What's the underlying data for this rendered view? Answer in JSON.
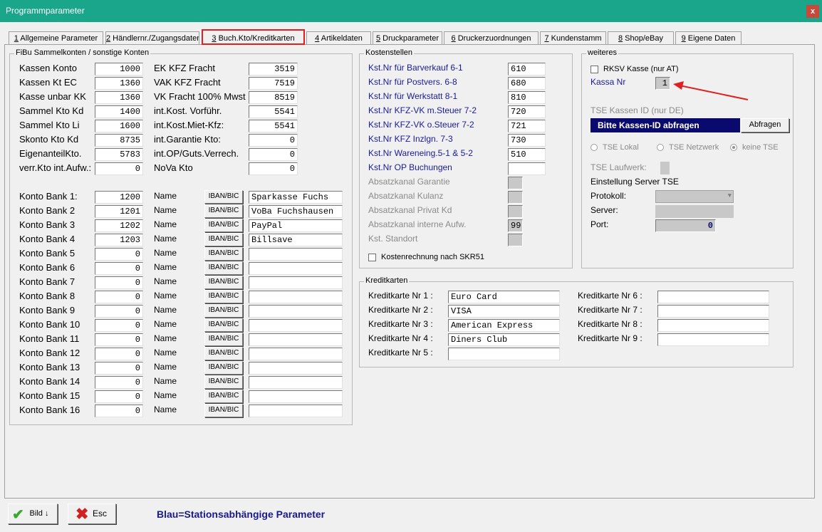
{
  "window": {
    "title": "Programmparameter",
    "close": "x"
  },
  "tabs": [
    {
      "num": "1",
      "label": " Allgemeine Parameter"
    },
    {
      "num": "2",
      "label": " Händlernr./Zugangsdaten"
    },
    {
      "num": "3",
      "label": " Buch.Kto/Kreditkarten"
    },
    {
      "num": "4",
      "label": " Artikeldaten"
    },
    {
      "num": "5",
      "label": " Druckparameter"
    },
    {
      "num": "6",
      "label": " Druckerzuordnungen"
    },
    {
      "num": "7",
      "label": " Kundenstamm"
    },
    {
      "num": "8",
      "label": " Shop/eBay"
    },
    {
      "num": "9",
      "label": " Eigene Daten"
    }
  ],
  "fibu": {
    "legend": "FiBu Sammelkonten / sonstige Konten",
    "left": [
      {
        "label": "Kassen Konto",
        "value": "1000"
      },
      {
        "label": "Kassen Kt EC",
        "value": "1360"
      },
      {
        "label": "Kasse unbar KK",
        "value": "1360"
      },
      {
        "label": "Sammel Kto Kd",
        "value": "1400"
      },
      {
        "label": "Sammel Kto Li",
        "value": "1600"
      },
      {
        "label": "Skonto Kto Kd",
        "value": "8735"
      },
      {
        "label": "EigenanteilKto.",
        "value": "5783"
      },
      {
        "label": "verr.Kto int.Aufw.:",
        "value": "0"
      }
    ],
    "right": [
      {
        "label": "EK KFZ Fracht",
        "value": "3519"
      },
      {
        "label": "VAK KFZ Fracht",
        "value": "7519"
      },
      {
        "label": "VK Fracht 100% Mwst",
        "value": "8519"
      },
      {
        "label": "int.Kost. Vorführ.",
        "value": "5541"
      },
      {
        "label": "int.Kost.Miet-Kfz:",
        "value": "5541"
      },
      {
        "label": "int.Garantie Kto:",
        "value": "0"
      },
      {
        "label": "int.OP/Guts.Verrech.",
        "value": "0"
      },
      {
        "label": "NoVa Kto",
        "value": "0"
      }
    ],
    "banks": [
      {
        "label": "Konto Bank 1:",
        "value": "1200",
        "name_label": "Name",
        "iban": "IBAN/BIC",
        "name": "Sparkasse Fuchs"
      },
      {
        "label": "Konto Bank 2",
        "value": "1201",
        "name_label": "Name",
        "iban": "IBAN/BIC",
        "name": "VoBa Fuchshausen"
      },
      {
        "label": "Konto Bank 3",
        "value": "1202",
        "name_label": "Name",
        "iban": "IBAN/BIC",
        "name": "PayPal"
      },
      {
        "label": "Konto Bank 4",
        "value": "1203",
        "name_label": "Name",
        "iban": "IBAN/BIC",
        "name": "Billsave"
      },
      {
        "label": "Konto Bank 5",
        "value": "0",
        "name_label": "Name",
        "iban": "IBAN/BIC",
        "name": ""
      },
      {
        "label": "Konto Bank 6",
        "value": "0",
        "name_label": "Name",
        "iban": "IBAN/BIC",
        "name": ""
      },
      {
        "label": "Konto Bank 7",
        "value": "0",
        "name_label": "Name",
        "iban": "IBAN/BIC",
        "name": ""
      },
      {
        "label": "Konto Bank 8",
        "value": "0",
        "name_label": "Name",
        "iban": "IBAN/BIC",
        "name": ""
      },
      {
        "label": "Konto Bank 9",
        "value": "0",
        "name_label": "Name",
        "iban": "IBAN/BIC",
        "name": ""
      },
      {
        "label": "Konto Bank 10",
        "value": "0",
        "name_label": "Name",
        "iban": "IBAN/BIC",
        "name": ""
      },
      {
        "label": "Konto Bank 11",
        "value": "0",
        "name_label": "Name",
        "iban": "IBAN/BIC",
        "name": ""
      },
      {
        "label": "Konto Bank 12",
        "value": "0",
        "name_label": "Name",
        "iban": "IBAN/BIC",
        "name": ""
      },
      {
        "label": "Konto Bank 13",
        "value": "0",
        "name_label": "Name",
        "iban": "IBAN/BIC",
        "name": ""
      },
      {
        "label": "Konto Bank 14",
        "value": "0",
        "name_label": "Name",
        "iban": "IBAN/BIC",
        "name": ""
      },
      {
        "label": "Konto Bank 15",
        "value": "0",
        "name_label": "Name",
        "iban": "IBAN/BIC",
        "name": ""
      },
      {
        "label": "Konto Bank 16",
        "value": "0",
        "name_label": "Name",
        "iban": "IBAN/BIC",
        "name": ""
      }
    ]
  },
  "kostenstellen": {
    "legend": "Kostenstellen",
    "items": [
      {
        "label": "Kst.Nr für Barverkauf  6-1",
        "value": "610",
        "style": "blue"
      },
      {
        "label": "Kst.Nr für Postvers.   6-8",
        "value": "680",
        "style": "blue"
      },
      {
        "label": "Kst.Nr für Werkstatt   8-1",
        "value": "810",
        "style": "blue"
      },
      {
        "label": "Kst.Nr KFZ-VK m.Steuer 7-2",
        "value": "720",
        "style": "blue"
      },
      {
        "label": "Kst.Nr KFZ-VK o.Steuer 7-2",
        "value": "721",
        "style": "blue"
      },
      {
        "label": "Kst.Nr KFZ Inzlgn.     7-3",
        "value": "730",
        "style": "blue"
      },
      {
        "label": "Kst.Nr Wareneing.5-1 & 5-2",
        "value": "510",
        "style": "blue"
      },
      {
        "label": "Kst.Nr OP Buchungen",
        "value": "",
        "style": "blue"
      },
      {
        "label": "Absatzkanal Garantie",
        "value": "",
        "style": "grey"
      },
      {
        "label": "Absatzkanal Kulanz",
        "value": "",
        "style": "grey"
      },
      {
        "label": "Absatzkanal Privat Kd",
        "value": "",
        "style": "grey"
      },
      {
        "label": "Absatzkanal interne Aufw.",
        "value": "99",
        "style": "grey"
      },
      {
        "label": "Kst. Standort",
        "value": "",
        "style": "grey"
      }
    ],
    "checkbox_label": "Kostenrechnung nach SKR51"
  },
  "weiteres": {
    "legend": "weiteres",
    "rksv_label": "RKSV Kasse (nur AT)",
    "kassa_label": "Kassa Nr",
    "kassa_value": "1",
    "tse_id_label": "TSE Kassen ID (nur DE)",
    "tse_bar_text": "Bitte Kassen-ID abfragen",
    "abfragen": "Abfragen",
    "radios": [
      {
        "label": "TSE Lokal",
        "selected": false
      },
      {
        "label": "TSE Netzwerk",
        "selected": false
      },
      {
        "label": "keine TSE",
        "selected": true
      }
    ],
    "laufwerk_label": "TSE Laufwerk:",
    "einstellung_label": "Einstellung Server TSE",
    "protokoll_label": "Protokoll:",
    "server_label": "Server:",
    "port_label": "Port:",
    "port_value": "0"
  },
  "kreditkarten": {
    "legend": "Kreditkarten",
    "left": [
      {
        "label": "Kreditkarte Nr 1 :",
        "value": "Euro Card"
      },
      {
        "label": "Kreditkarte Nr 2 :",
        "value": "VISA"
      },
      {
        "label": "Kreditkarte Nr 3 :",
        "value": "American Express"
      },
      {
        "label": "Kreditkarte Nr 4 :",
        "value": "Diners Club"
      },
      {
        "label": "Kreditkarte Nr 5 :",
        "value": ""
      }
    ],
    "right": [
      {
        "label": "Kreditkarte Nr 6 :",
        "value": ""
      },
      {
        "label": "Kreditkarte Nr 7 :",
        "value": ""
      },
      {
        "label": "Kreditkarte Nr 8 :",
        "value": ""
      },
      {
        "label": "Kreditkarte Nr 9 :",
        "value": ""
      }
    ]
  },
  "footer": {
    "bild_label": "Bild",
    "esc_label": "Esc",
    "note": "Blau=Stationsabhängige Parameter"
  },
  "colors": {
    "titlebar": "#1aa68a",
    "accent_red": "#e02020",
    "blue_text": "#1a1a9a",
    "navy_bar": "#0a0a6e"
  }
}
